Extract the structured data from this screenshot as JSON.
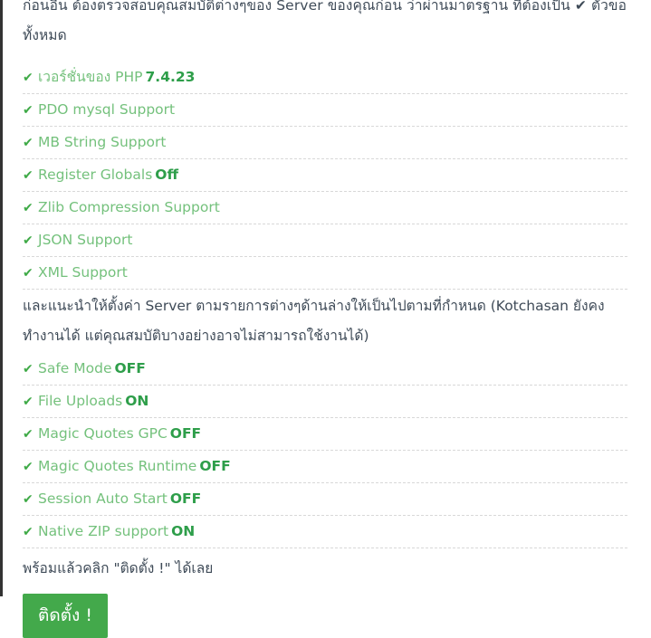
{
  "intro": {
    "clipped_line": "ก่อนอื่น ต้องตรวจสอบคุณสมบัติต่างๆของ Server ของคุณก่อน ว่าผ่านมาตรฐาน ที่ต้องเป็น ✔ ตัวของ",
    "line2": "ทั้งหมด"
  },
  "requirements": [
    {
      "icon": "check-icon",
      "label": "เวอร์ชั่นของ PHP",
      "value": "7.4.23"
    },
    {
      "icon": "check-icon",
      "label": "PDO mysql Support",
      "value": ""
    },
    {
      "icon": "check-icon",
      "label": "MB String Support",
      "value": ""
    },
    {
      "icon": "check-icon",
      "label": "Register Globals",
      "value": "Off"
    },
    {
      "icon": "check-icon",
      "label": "Zlib Compression Support",
      "value": ""
    },
    {
      "icon": "check-icon",
      "label": "JSON Support",
      "value": ""
    },
    {
      "icon": "check-icon",
      "label": "XML Support",
      "value": ""
    }
  ],
  "recommend_note": "และแนะนำให้ตั้งค่า Server ตามรายการต่างๆด้านล่างให้เป็นไปตามที่กำหนด (Kotchasan ยังคงทำงานได้ แต่คุณสมบัติบางอย่างอาจไม่สามารถใช้งานได้)",
  "settings": [
    {
      "icon": "check-icon",
      "label": "Safe Mode",
      "value": "OFF"
    },
    {
      "icon": "check-icon",
      "label": "File Uploads",
      "value": "ON"
    },
    {
      "icon": "check-icon",
      "label": "Magic Quotes GPC",
      "value": "OFF"
    },
    {
      "icon": "check-icon",
      "label": "Magic Quotes Runtime",
      "value": "OFF"
    },
    {
      "icon": "check-icon",
      "label": "Session Auto Start",
      "value": "OFF"
    },
    {
      "icon": "check-icon",
      "label": "Native ZIP support",
      "value": "ON"
    }
  ],
  "ready_note": "พร้อมแล้วคลิก \"ติดตั้ง !\" ได้เลย",
  "install_button": {
    "label": "ติดตั้ง !",
    "color": "#43a94b",
    "text_color": "#ffffff"
  },
  "icons": {
    "check": "✔"
  },
  "colors": {
    "accent_green": "#43a94b",
    "label_green": "#74c17c",
    "value_green": "#2e9e4a",
    "tick_green": "#3faa47",
    "body_text": "#3f4b58",
    "divider": "#d8d8d8",
    "left_border": "#333333"
  }
}
